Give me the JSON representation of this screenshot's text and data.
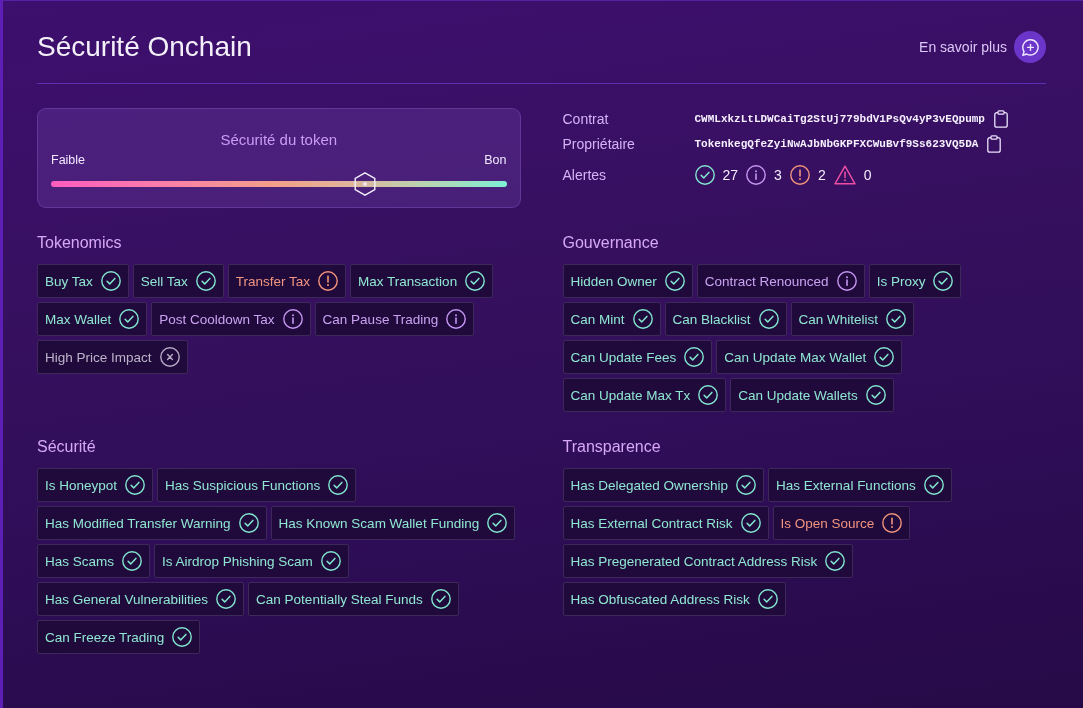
{
  "header": {
    "title": "Sécurité Onchain",
    "link": "En savoir plus"
  },
  "gauge": {
    "title": "Sécurité du token",
    "low_label": "Faible",
    "high_label": "Bon",
    "level": 0.69
  },
  "details": [
    {
      "label": "Contrat",
      "value": "CWMLxkzLtLDWCaiTg2StUj779bdV1PsQv4yP3vEQpump"
    },
    {
      "label": "Propriétaire",
      "value": "TokenkegQfeZyiNwAJbNbGKPFXCWuBvf9Ss623VQ5DA"
    }
  ],
  "alerts": {
    "label": "Alertes",
    "counts": [
      {
        "kind": "pass",
        "count": "27"
      },
      {
        "kind": "info",
        "count": "3"
      },
      {
        "kind": "warning",
        "count": "2"
      },
      {
        "kind": "danger",
        "count": "0"
      }
    ]
  },
  "sections": [
    {
      "title": "Tokenomics",
      "checks": [
        {
          "label": "Buy Tax",
          "kind": "pass"
        },
        {
          "label": "Sell Tax",
          "kind": "pass"
        },
        {
          "label": "Transfer Tax",
          "kind": "warning"
        },
        {
          "label": "Max Transaction",
          "kind": "pass"
        },
        {
          "label": "Max Wallet",
          "kind": "pass"
        },
        {
          "label": "Post Cooldown Tax",
          "kind": "info"
        },
        {
          "label": "Can Pause Trading",
          "kind": "info"
        },
        {
          "label": "High Price Impact",
          "kind": "unknown"
        }
      ]
    },
    {
      "title": "Gouvernance",
      "checks": [
        {
          "label": "Hidden Owner",
          "kind": "pass"
        },
        {
          "label": "Contract Renounced",
          "kind": "info"
        },
        {
          "label": "Is Proxy",
          "kind": "pass"
        },
        {
          "label": "Can Mint",
          "kind": "pass"
        },
        {
          "label": "Can Blacklist",
          "kind": "pass"
        },
        {
          "label": "Can Whitelist",
          "kind": "pass"
        },
        {
          "label": "Can Update Fees",
          "kind": "pass"
        },
        {
          "label": "Can Update Max Wallet",
          "kind": "pass"
        },
        {
          "label": "Can Update Max Tx",
          "kind": "pass"
        },
        {
          "label": "Can Update Wallets",
          "kind": "pass"
        }
      ]
    },
    {
      "title": "Sécurité",
      "checks": [
        {
          "label": "Is Honeypot",
          "kind": "pass"
        },
        {
          "label": "Has Suspicious Functions",
          "kind": "pass"
        },
        {
          "label": "Has Modified Transfer Warning",
          "kind": "pass"
        },
        {
          "label": "Has Known Scam Wallet Funding",
          "kind": "pass"
        },
        {
          "label": "Has Scams",
          "kind": "pass"
        },
        {
          "label": "Is Airdrop Phishing Scam",
          "kind": "pass"
        },
        {
          "label": "Has General Vulnerabilities",
          "kind": "pass"
        },
        {
          "label": "Can Potentially Steal Funds",
          "kind": "pass"
        },
        {
          "label": "Can Freeze Trading",
          "kind": "pass"
        }
      ]
    },
    {
      "title": "Transparence",
      "checks": [
        {
          "label": "Has Delegated Ownership",
          "kind": "pass"
        },
        {
          "label": "Has External Functions",
          "kind": "pass"
        },
        {
          "label": "Has External Contract Risk",
          "kind": "pass"
        },
        {
          "label": "Is Open Source",
          "kind": "warning"
        },
        {
          "label": "Has Pregenerated Contract Address Risk",
          "kind": "pass"
        },
        {
          "label": "Has Obfuscated Address Risk",
          "kind": "pass"
        }
      ]
    }
  ]
}
